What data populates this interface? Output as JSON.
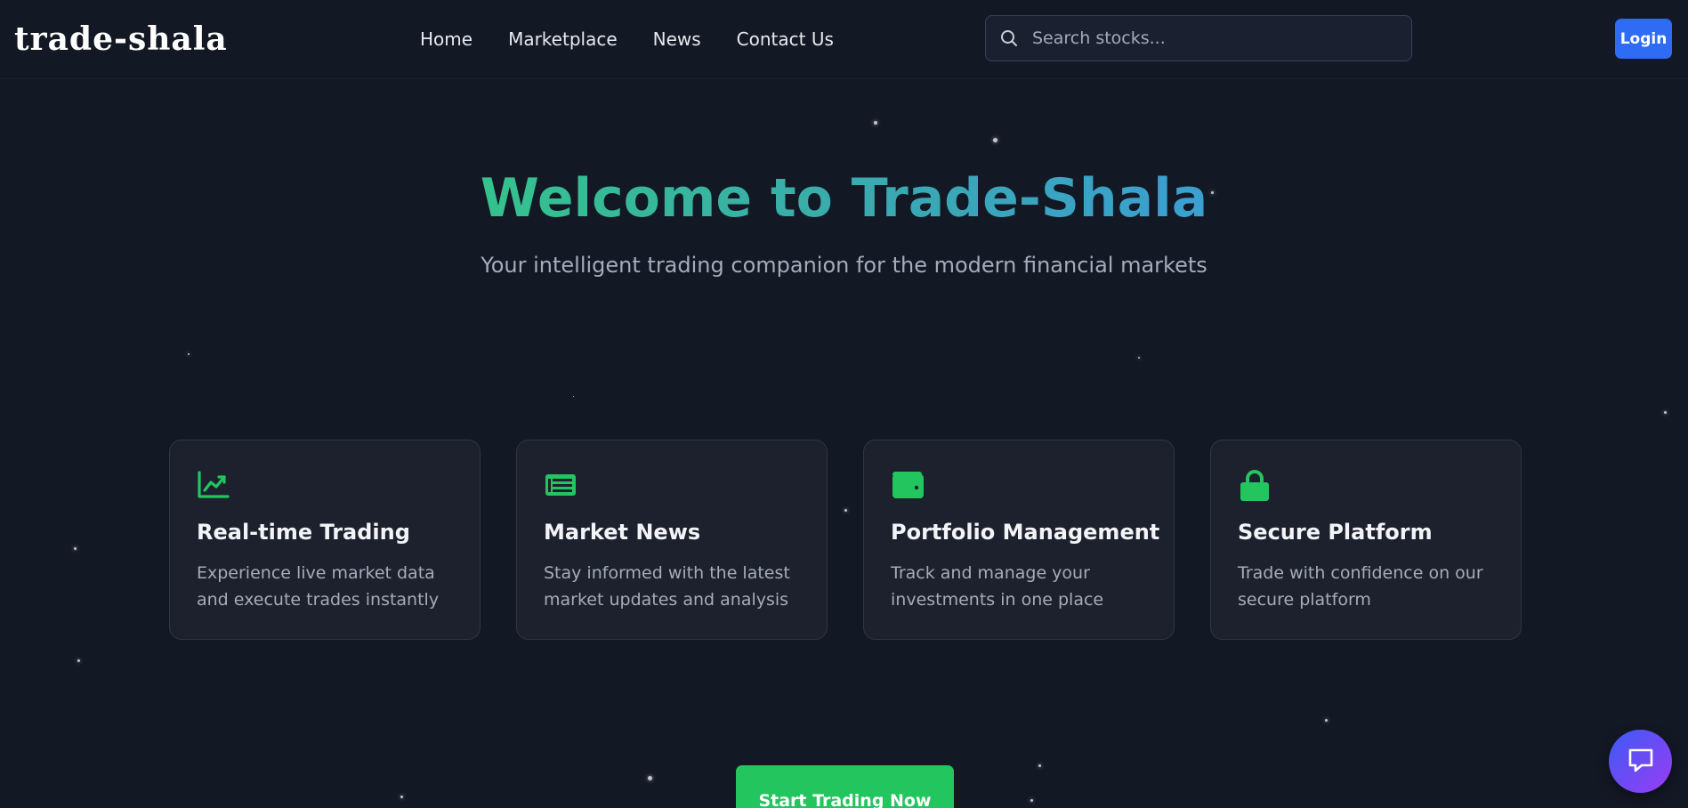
{
  "brand": {
    "logo_text": "trade-shala"
  },
  "nav": {
    "items": [
      {
        "label": "Home"
      },
      {
        "label": "Marketplace"
      },
      {
        "label": "News"
      },
      {
        "label": "Contact Us"
      }
    ]
  },
  "search": {
    "placeholder": "Search stocks...",
    "icon": "search-icon"
  },
  "auth": {
    "login_label": "Login"
  },
  "hero": {
    "title": "Welcome to Trade-Shala",
    "subtitle": "Your intelligent trading companion for the modern financial markets"
  },
  "features": [
    {
      "icon": "chart-line-icon",
      "title": "Real-time Trading",
      "description": "Experience live market data and execute trades instantly"
    },
    {
      "icon": "newspaper-icon",
      "title": "Market News",
      "description": "Stay informed with the latest market updates and analysis"
    },
    {
      "icon": "wallet-icon",
      "title": "Portfolio Management",
      "description": "Track and manage your investments in one place"
    },
    {
      "icon": "lock-icon",
      "title": "Secure Platform",
      "description": "Trade with confidence on our secure platform"
    }
  ],
  "cta": {
    "label": "Start Trading Now"
  },
  "chat": {
    "icon": "chat-bubble-icon"
  },
  "colors": {
    "background": "#131825",
    "card": "#1c212d",
    "accent_green": "#22c55e",
    "login_blue": "#2e6cf6",
    "title_gradient_start": "#35c28c",
    "title_gradient_end": "#3b9fd2"
  }
}
